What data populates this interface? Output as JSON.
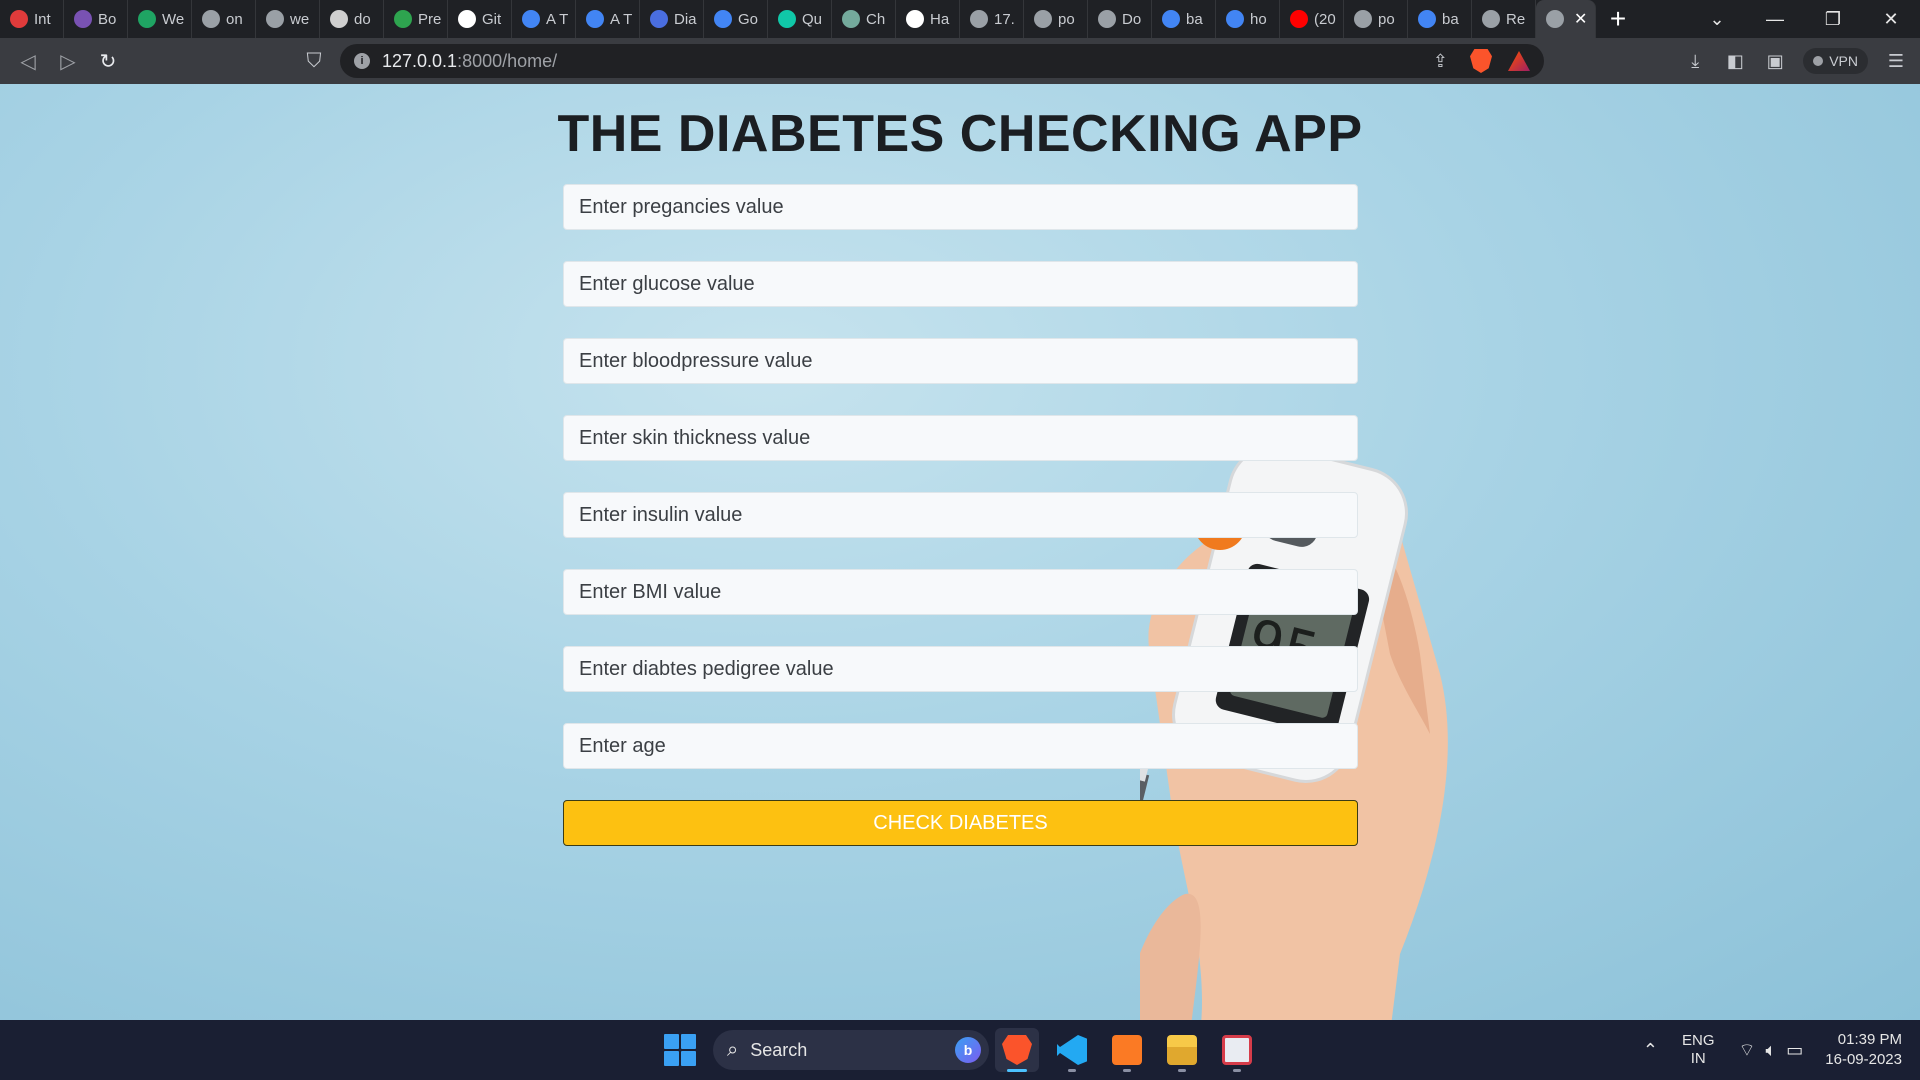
{
  "browser": {
    "tabs": [
      {
        "title": "Int",
        "fav": "#e03b3b"
      },
      {
        "title": "Bo",
        "fav": "#7952b3"
      },
      {
        "title": "We",
        "fav": "#1fa463"
      },
      {
        "title": "on",
        "fav": "#9aa0a6"
      },
      {
        "title": "we",
        "fav": "#9aa0a6"
      },
      {
        "title": "do",
        "fav": "#cfcfcf"
      },
      {
        "title": "Pre",
        "fav": "#2ea44f"
      },
      {
        "title": "Git",
        "fav": "#ffffff"
      },
      {
        "title": "A T",
        "fav": "#4285f4"
      },
      {
        "title": "A T",
        "fav": "#4285f4"
      },
      {
        "title": "Dia",
        "fav": "#4a6ee0"
      },
      {
        "title": "Go",
        "fav": "#4285f4"
      },
      {
        "title": "Qu",
        "fav": "#10c8a8"
      },
      {
        "title": "Ch",
        "fav": "#74aa9c"
      },
      {
        "title": "Ha",
        "fav": "#ffffff"
      },
      {
        "title": "17.",
        "fav": "#9aa0a6"
      },
      {
        "title": "po",
        "fav": "#9aa0a6"
      },
      {
        "title": "Do",
        "fav": "#9aa0a6"
      },
      {
        "title": "ba",
        "fav": "#4285f4"
      },
      {
        "title": "ho",
        "fav": "#4285f4"
      },
      {
        "title": "(20",
        "fav": "#ff0000"
      },
      {
        "title": "po",
        "fav": "#9aa0a6"
      },
      {
        "title": "ba",
        "fav": "#4285f4"
      },
      {
        "title": "Re",
        "fav": "#9aa0a6"
      }
    ],
    "active_tab_fav": "#9aa0a6",
    "new_tab_label": "+",
    "url_host": "127.0.0.1",
    "url_path": ":8000/home/",
    "vpn_label": "VPN",
    "window_controls": [
      "chevron-down",
      "minimize",
      "restore",
      "close"
    ]
  },
  "page": {
    "title": "THE DIABETES CHECKING APP",
    "fields": {
      "pregnancies": "Enter pregancies value",
      "glucose": "Enter glucose value",
      "bloodpressure": "Enter bloodpressure value",
      "skin_thickness": "Enter skin thickness value",
      "insulin": "Enter insulin value",
      "bmi": "Enter BMI value",
      "pedigree": "Enter diabtes pedigree value",
      "age": "Enter age"
    },
    "submit_label": "CHECK DIABETES",
    "meter_reading": "95",
    "accent_color": "#fdc111"
  },
  "taskbar": {
    "search_label": "Search",
    "apps": [
      "brave-browser",
      "vs-code",
      "xampp",
      "file-explorer",
      "snipping-tool"
    ],
    "lang_line1": "ENG",
    "lang_line2": "IN",
    "time": "01:39 PM",
    "date": "16-09-2023"
  }
}
